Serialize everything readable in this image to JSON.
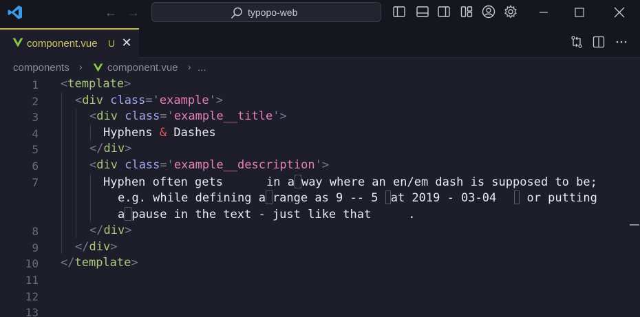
{
  "titlebar": {
    "search_text": "typopo-web",
    "icons": [
      "vscode-logo",
      "back-arrow",
      "forward-arrow",
      "search-icon",
      "toggle-primary-sidebar-icon",
      "toggle-panel-icon",
      "toggle-secondary-sidebar-icon",
      "customize-layout-icon",
      "account-icon",
      "settings-gear-icon",
      "minimize-icon",
      "maximize-icon",
      "close-window-icon"
    ]
  },
  "tabs": [
    {
      "label": "component.vue",
      "status": "U",
      "close": "✕"
    }
  ],
  "tab_actions": [
    "open-changes-icon",
    "split-editor-icon",
    "more-actions-icon"
  ],
  "breadcrumb": {
    "folder": "components",
    "file": "component.vue",
    "ellipsis": "..."
  },
  "editor": {
    "line_numbers": [
      "1",
      "2",
      "3",
      "4",
      "5",
      "6",
      "7",
      "8",
      "9",
      "10",
      "11",
      "12",
      "13"
    ],
    "code": {
      "l1_tag": "template",
      "l2_tag": "div",
      "l2_attr": "class",
      "l2_val": "example",
      "l3_tag": "div",
      "l3_attr": "class",
      "l3_val": "example__title",
      "l4_text_a": "Hyphens ",
      "l4_amp": "&",
      "l4_text_b": " Dashes",
      "l5_tag": "div",
      "l6_tag": "div",
      "l6_attr": "class",
      "l6_val": "example__description",
      "l7_a": "Hyphen often gets",
      "l7_b": "in a",
      "l7_c": "way where an en/em dash is supposed to be;",
      "l7w_a": "e.g. while defining a",
      "l7w_b": "range as 9 -- 5 ",
      "l7w_c": "at 2019 - 03-04",
      "l7w_d": " or putting",
      "l7w2_a": "a",
      "l7w2_b": "pause in the text - just like that",
      "l7w2_c": ".",
      "l8_tag": "div",
      "l9_tag": "div",
      "l10_tag": "template"
    }
  }
}
